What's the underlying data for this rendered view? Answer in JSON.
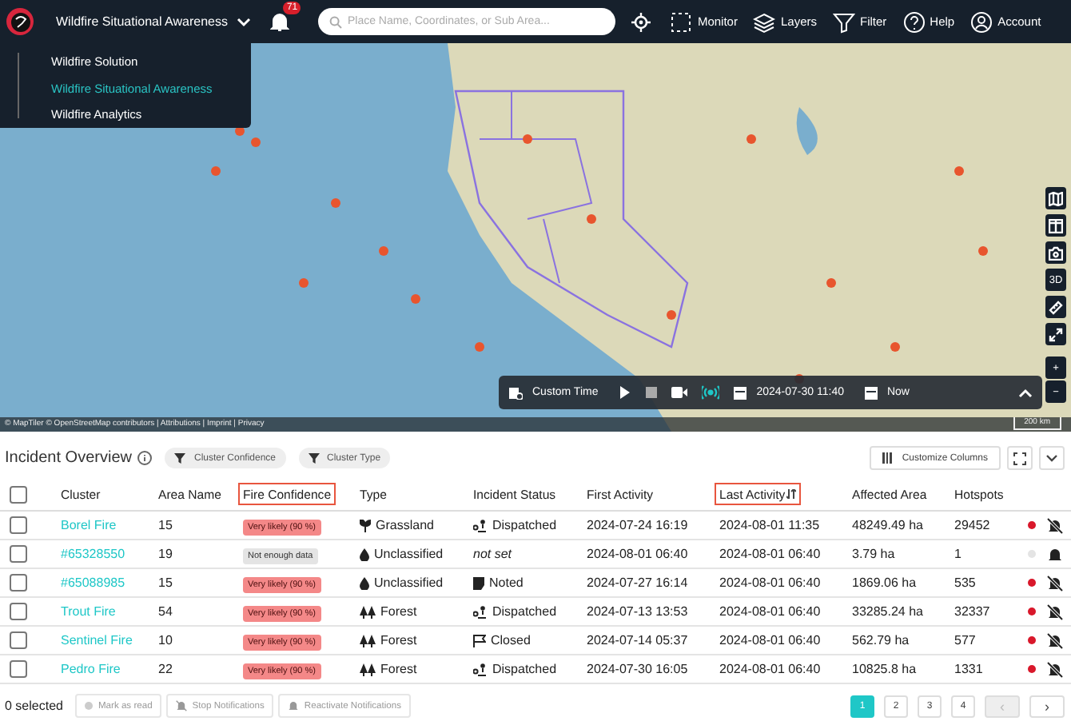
{
  "header": {
    "app_title": "Wildfire Situational Awareness",
    "notification_count": "71",
    "search": {
      "placeholder": "Place Name, Coordinates, or Sub Area..."
    },
    "nav": [
      {
        "label": "Monitor",
        "kind": "monitor"
      },
      {
        "label": "Layers",
        "kind": "layers"
      },
      {
        "label": "Filter",
        "kind": "filter"
      },
      {
        "label": "Help",
        "kind": "help"
      },
      {
        "label": "Account",
        "kind": "account"
      }
    ]
  },
  "app_menu": [
    {
      "label": "Wildfire Solution",
      "selected": false
    },
    {
      "label": "Wildfire Situational Awareness",
      "selected": true
    },
    {
      "label": "Wildfire Analytics",
      "selected": false
    }
  ],
  "map": {
    "attribution": "© MapTiler © OpenStreetMap contributors | Attributions | Imprint | Privacy",
    "scale": "200 km",
    "tools": [
      {
        "kind": "map"
      },
      {
        "kind": "split"
      },
      {
        "kind": "camera"
      },
      {
        "kind": "text",
        "label": "3D"
      },
      {
        "kind": "ruler"
      },
      {
        "kind": "expand"
      }
    ],
    "zoom_in": "+",
    "zoom_out": "−"
  },
  "time_bar": {
    "mode": "Custom Time",
    "live": true,
    "start": "2024-07-30 11:40",
    "end": "Now"
  },
  "incidents": {
    "title": "Incident Overview",
    "filters": [
      "Cluster Confidence",
      "Cluster Type"
    ],
    "customize": "Customize Columns",
    "select_all": {
      "checked": false
    },
    "columns": [
      {
        "label": "Cluster",
        "highlighted": false,
        "sorted": false
      },
      {
        "label": "Area Name",
        "highlighted": false,
        "sorted": false
      },
      {
        "label": "Fire Confidence",
        "highlighted": true,
        "sorted": false
      },
      {
        "label": "Type",
        "highlighted": false,
        "sorted": false
      },
      {
        "label": "Incident Status",
        "highlighted": false,
        "sorted": false
      },
      {
        "label": "First Activity",
        "highlighted": false,
        "sorted": false
      },
      {
        "label": "Last Activity",
        "highlighted": true,
        "sorted": true
      },
      {
        "label": "Affected Area",
        "highlighted": false,
        "sorted": false
      },
      {
        "label": "Hotspots",
        "highlighted": false,
        "sorted": false
      }
    ],
    "rows": [
      {
        "checked": false,
        "cluster": "Borel Fire",
        "area": "15",
        "confidence": {
          "label": "Very likely (90 %)",
          "kind": "high"
        },
        "type": {
          "label": "Grassland",
          "kind": "grassland"
        },
        "status": {
          "label": "Dispatched",
          "kind": "dispatched"
        },
        "first": "2024-07-24 16:19",
        "last": "2024-08-01 11:35",
        "affected": "48249.49 ha",
        "hotspots": "29452",
        "color": "#d9182b",
        "muted": true
      },
      {
        "checked": false,
        "cluster": "#65328550",
        "area": "19",
        "confidence": {
          "label": "Not enough data",
          "kind": "unknown"
        },
        "type": {
          "label": "Unclassified",
          "kind": "unclassified"
        },
        "status": {
          "label": "not set",
          "kind": "none"
        },
        "first": "2024-08-01 06:40",
        "last": "2024-08-01 06:40",
        "affected": "3.79 ha",
        "hotspots": "1",
        "color": "#e4e4e4",
        "muted": false
      },
      {
        "checked": false,
        "cluster": "#65088985",
        "area": "15",
        "confidence": {
          "label": "Very likely (90 %)",
          "kind": "high"
        },
        "type": {
          "label": "Unclassified",
          "kind": "unclassified"
        },
        "status": {
          "label": "Noted",
          "kind": "noted"
        },
        "first": "2024-07-27 16:14",
        "last": "2024-08-01 06:40",
        "affected": "1869.06 ha",
        "hotspots": "535",
        "color": "#d9182b",
        "muted": true
      },
      {
        "checked": false,
        "cluster": "Trout Fire",
        "area": "54",
        "confidence": {
          "label": "Very likely (90 %)",
          "kind": "high"
        },
        "type": {
          "label": "Forest",
          "kind": "forest"
        },
        "status": {
          "label": "Dispatched",
          "kind": "dispatched"
        },
        "first": "2024-07-13 13:53",
        "last": "2024-08-01 06:40",
        "affected": "33285.24 ha",
        "hotspots": "32337",
        "color": "#d9182b",
        "muted": true
      },
      {
        "checked": false,
        "cluster": "Sentinel Fire",
        "area": "10",
        "confidence": {
          "label": "Very likely (90 %)",
          "kind": "high"
        },
        "type": {
          "label": "Forest",
          "kind": "forest"
        },
        "status": {
          "label": "Closed",
          "kind": "closed"
        },
        "first": "2024-07-14 05:37",
        "last": "2024-08-01 06:40",
        "affected": "562.79 ha",
        "hotspots": "577",
        "color": "#d9182b",
        "muted": true
      },
      {
        "checked": false,
        "cluster": "Pedro Fire",
        "area": "22",
        "confidence": {
          "label": "Very likely (90 %)",
          "kind": "high"
        },
        "type": {
          "label": "Forest",
          "kind": "forest"
        },
        "status": {
          "label": "Dispatched",
          "kind": "dispatched"
        },
        "first": "2024-07-30 16:05",
        "last": "2024-08-01 06:40",
        "affected": "10825.8 ha",
        "hotspots": "1331",
        "color": "#d9182b",
        "muted": true
      }
    ],
    "selected_count": "0 selected",
    "actions": [
      {
        "label": "Mark as read",
        "kind": "read",
        "disabled": true
      },
      {
        "label": "Stop Notifications",
        "kind": "mute",
        "disabled": true
      },
      {
        "label": "Reactivate Notifications",
        "kind": "bell",
        "disabled": true
      }
    ],
    "pages": [
      {
        "label": "1",
        "selected": true
      },
      {
        "label": "2",
        "selected": false
      },
      {
        "label": "3",
        "selected": false
      },
      {
        "label": "4",
        "selected": false
      }
    ],
    "prev": {
      "label": "‹",
      "disabled": true
    },
    "next": {
      "label": "›",
      "disabled": false
    }
  }
}
